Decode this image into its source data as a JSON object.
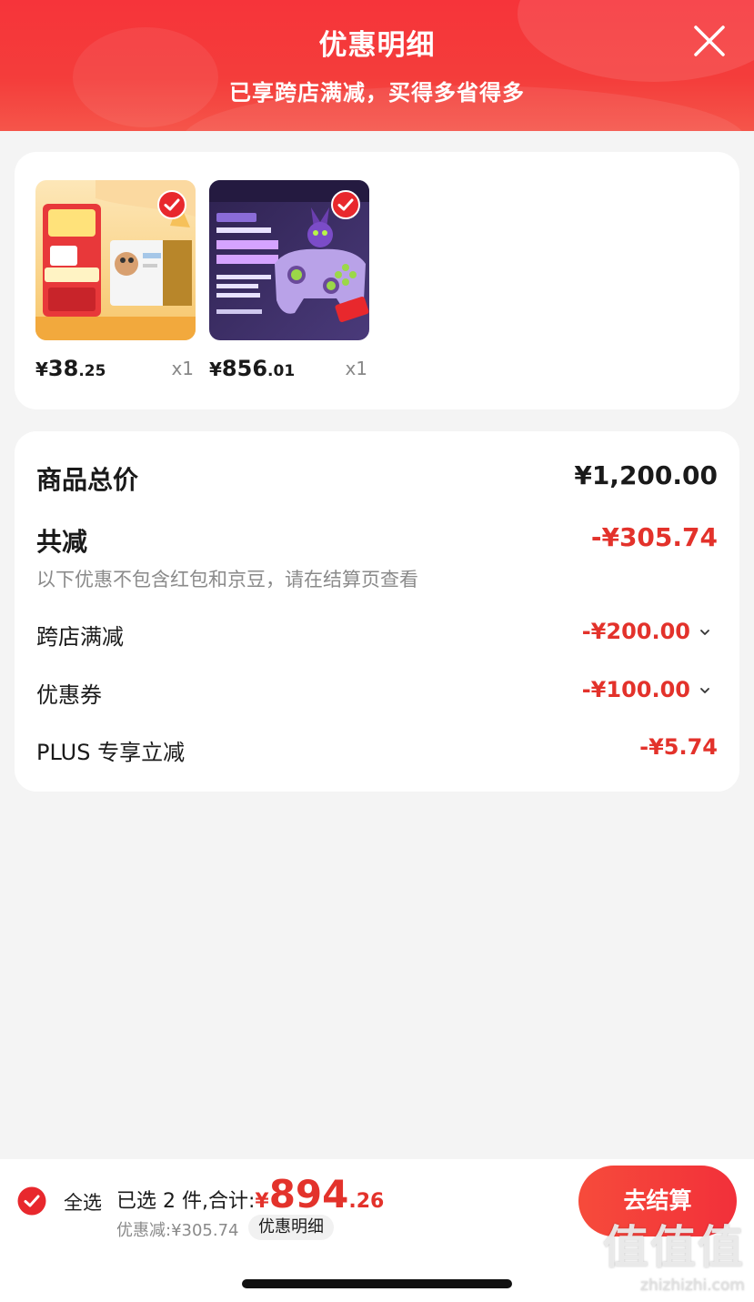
{
  "header": {
    "title": "优惠明细",
    "subtitle": "已享跨店满减，买得多省得多"
  },
  "products": [
    {
      "price_symbol": "¥",
      "price_int": "38",
      "price_dec": ".25",
      "qty": "x1",
      "thumb": {
        "banner": "宠物健康 心动购物季",
        "price_label": "51",
        "discount": "1件5.4折",
        "line1": "美国进口",
        "line2": "正品保障",
        "brand": "revolution"
      }
    },
    {
      "price_symbol": "¥",
      "price_int": "856",
      "price_dec": ".01",
      "qty": "x1",
      "thumb": {
        "brand": "飞智",
        "collab": "新世纪福音战士",
        "tag": "EVA联名款",
        "model": "飞智八爪鱼4",
        "slogan1": "实「力」之上",
        "slogan2": "更「沉浸」",
        "feat1": "力调节合金摇杆",
        "feat2": "力反馈扳机",
        "feat3": "智能交互屏",
        "platforms": "PC/Switch/手机"
      }
    }
  ],
  "totals": {
    "goods_total_label": "商品总价",
    "goods_total_value": "¥1,200.00",
    "reduction_label": "共减",
    "reduction_value": "-¥305.74",
    "note": "以下优惠不包含红包和京豆，请在结算页查看",
    "items": [
      {
        "label": "跨店满减",
        "value": "-¥200.00",
        "expandable": true
      },
      {
        "label": "优惠券",
        "value": "-¥100.00",
        "expandable": true
      },
      {
        "label": "PLUS 专享立减",
        "value": "-¥5.74",
        "expandable": false
      }
    ]
  },
  "bottom": {
    "select_all": "全选",
    "selected_prefix": "已选 2 件,合计:",
    "total_symbol": "¥",
    "total_int": "894",
    "total_dec": ".26",
    "discount_text": "优惠减:¥305.74",
    "detail_chip": "优惠明细",
    "checkout": "去结算"
  },
  "watermark": {
    "logo": "值值值",
    "url": "zhizhizhi.com"
  },
  "colors": {
    "accent_red": "#e3322b",
    "header_red": "#f6343a"
  }
}
